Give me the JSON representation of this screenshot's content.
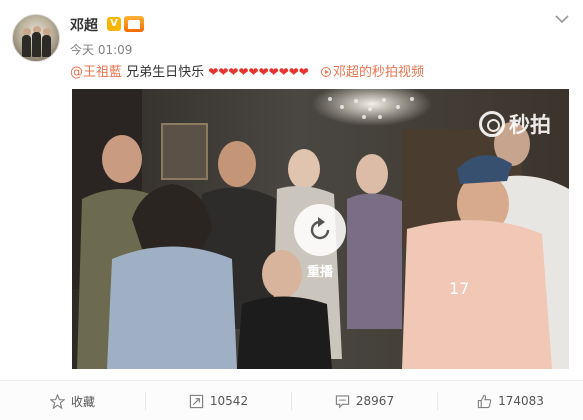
{
  "post": {
    "username": "邓超",
    "v_badge": "V",
    "time": "今天 01:09",
    "mention": "@王祖藍",
    "text": "兄弟生日快乐",
    "hearts": "❤❤❤❤❤❤❤❤❤❤",
    "video_link": "邓超的秒拍视频"
  },
  "video": {
    "watermark": "秒拍",
    "replay_label": "重播"
  },
  "actions": {
    "favorite": "收藏",
    "repost": "10542",
    "comment": "28967",
    "like": "174083"
  },
  "colors": {
    "link_orange": "#eb7350",
    "heart_red": "#e8322d",
    "v_badge_yellow": "#f7b500"
  }
}
